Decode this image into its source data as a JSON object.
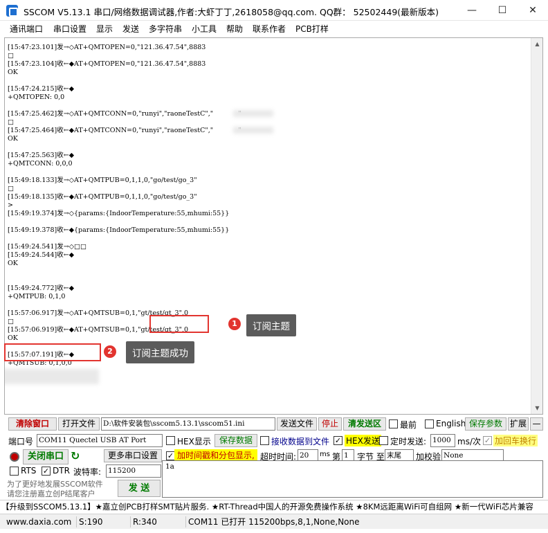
{
  "window": {
    "title": "SSCOM V5.13.1 串口/网络数据调试器,作者:大虾丁丁,2618058@qq.com. QQ群： 52502449(最新版本)",
    "minimize": "—",
    "maximize": "☐",
    "close": "✕"
  },
  "menu": [
    "通讯端口",
    "串口设置",
    "显示",
    "发送",
    "多字符串",
    "小工具",
    "帮助",
    "联系作者",
    "PCB打样"
  ],
  "log": [
    "[15:47:23.101]发→◇AT+QMTOPEN=0,\"121.36.47.54\",8883",
    "□",
    "[15:47:23.104]收←◆AT+QMTOPEN=0,\"121.36.47.54\",8883",
    "OK",
    "",
    "[15:47:24.215]收←◆",
    "+QMTOPEN: 0,0",
    "",
    "[15:47:25.462]发→◇AT+QMTCONN=0,\"runyi\",\"raoneTestC\",\"            \"",
    "□",
    "[15:47:25.464]收←◆AT+QMTCONN=0,\"runyi\",\"raoneTestC\",\"            \"",
    "OK",
    "",
    "[15:47:25.563]收←◆",
    "+QMTCONN: 0,0,0",
    "",
    "[15:49:18.133]发→◇AT+QMTPUB=0,1,1,0,\"go/test/go_3\"",
    "□",
    "[15:49:18.135]收←◆AT+QMTPUB=0,1,1,0,\"go/test/go_3\"",
    ">",
    "[15:49:19.374]发→◇{params:{IndoorTemperature:55,mhumi:55}}",
    "",
    "[15:49:19.378]收←◆{params:{IndoorTemperature:55,mhumi:55}}",
    "",
    "[15:49:24.541]发→◇□□",
    "[15:49:24.544]收←◆",
    "OK",
    "",
    "",
    "[15:49:24.772]收←◆",
    "+QMTPUB: 0,1,0",
    "",
    "[15:57:06.917]发→◇AT+QMTSUB=0,1,\"gt/test/gt_3\",0",
    "□",
    "[15:57:06.919]收←◆AT+QMTSUB=0,1,\"gt/test/gt_3\",0",
    "OK",
    "",
    "[15:57:07.191]收←◆",
    "+QMTSUB: 0,1,0,0"
  ],
  "annotations": {
    "one": {
      "num": "1",
      "text": "订阅主题"
    },
    "two": {
      "num": "2",
      "text": "订阅主题成功"
    }
  },
  "toolbar": {
    "clear_window": "清除窗口",
    "open_file": "打开文件",
    "file_path": "D:\\软件安装包\\sscom5.13.1\\sscom51.ini",
    "send_file": "发送文件",
    "stop": "停止",
    "clear_send": "清发送区",
    "topmost": "最前",
    "english": "English",
    "save_params": "保存参数",
    "expand": "扩展",
    "collapse": "—"
  },
  "panel": {
    "port_label": "端口号",
    "port_value": "COM11 Quectel USB AT Port",
    "hex_display": "HEX显示",
    "save_data": "保存数据",
    "recv_to_file": "接收数据到文件",
    "hex_send": "HEX发送",
    "timed_send": "定时发送:",
    "interval": "1000",
    "interval_unit": "ms/次",
    "add_crlf": "加回车换行",
    "close_port": "关闭串口",
    "more_settings": "更多串口设置",
    "timestamp": "加时间戳和分包显示,",
    "timeout_label": "超时时间:",
    "timeout_value": "20",
    "ms": "ms",
    "byte_label": "第",
    "byte_value": "1",
    "byte_unit": "字节 至",
    "end_value": "末尾",
    "checksum_label": "加校验",
    "checksum_value": "None",
    "rts": "RTS",
    "dtr": "DTR",
    "baud_label": "波特率:",
    "baud_value": "115200",
    "send_button": "发  送",
    "send_text": "1a",
    "promo_line1": "为了更好地发展SSCOM软件",
    "promo_line2": "请您注册嘉立创P结尾客户"
  },
  "adbar": "【升级到SSCOM5.13.1】★嘉立创PCB打样SMT贴片服务. ★RT-Thread中国人的开源免费操作系统 ★8KM远距离WiFi可自组网 ★新一代WiFi芯片兼容",
  "status": {
    "site": "www.daxia.com",
    "sent": "S:190",
    "recv": "R:340",
    "port_state": "COM11 已打开  115200bps,8,1,None,None"
  }
}
